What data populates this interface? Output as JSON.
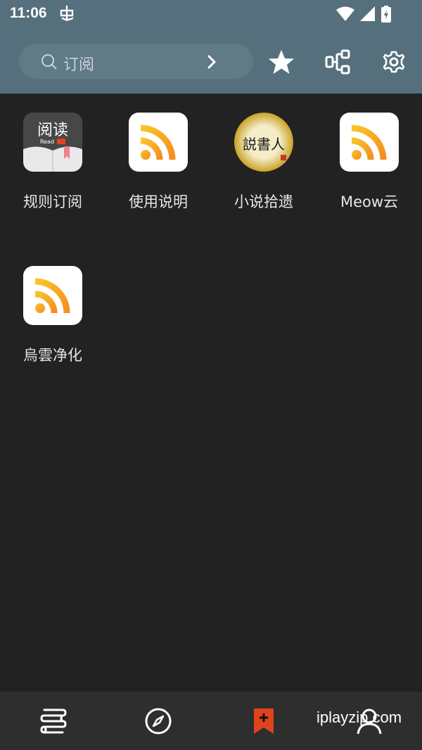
{
  "status": {
    "time": "11:06",
    "notification_icon": "app-notification-icon"
  },
  "search": {
    "placeholder": "订阅"
  },
  "toolbar": {
    "favorite_icon": "star-icon",
    "rule_icon": "rules-tree-icon",
    "settings_icon": "gear-icon"
  },
  "subscriptions": [
    {
      "label": "规则订阅",
      "icon": "read-app-icon",
      "icon_text": "阅读",
      "icon_sub": "Read"
    },
    {
      "label": "使用说明",
      "icon": "rss-icon"
    },
    {
      "label": "小说拾遗",
      "icon": "storyteller-icon",
      "icon_text": "説書人"
    },
    {
      "label": "Meow云",
      "icon": "rss-icon"
    },
    {
      "label": "烏雲净化",
      "icon": "rss-icon"
    }
  ],
  "bottom_nav": [
    {
      "name": "bookshelf",
      "icon": "books-icon"
    },
    {
      "name": "discover",
      "icon": "compass-icon"
    },
    {
      "name": "subscribe",
      "icon": "bookmark-add-icon",
      "active": true
    },
    {
      "name": "me",
      "icon": "person-icon"
    }
  ],
  "watermark": "iplayzip.com",
  "colors": {
    "topbar": "#55707c",
    "background": "#222222",
    "accent": "#e0431f",
    "rss": "#f7a21b"
  }
}
